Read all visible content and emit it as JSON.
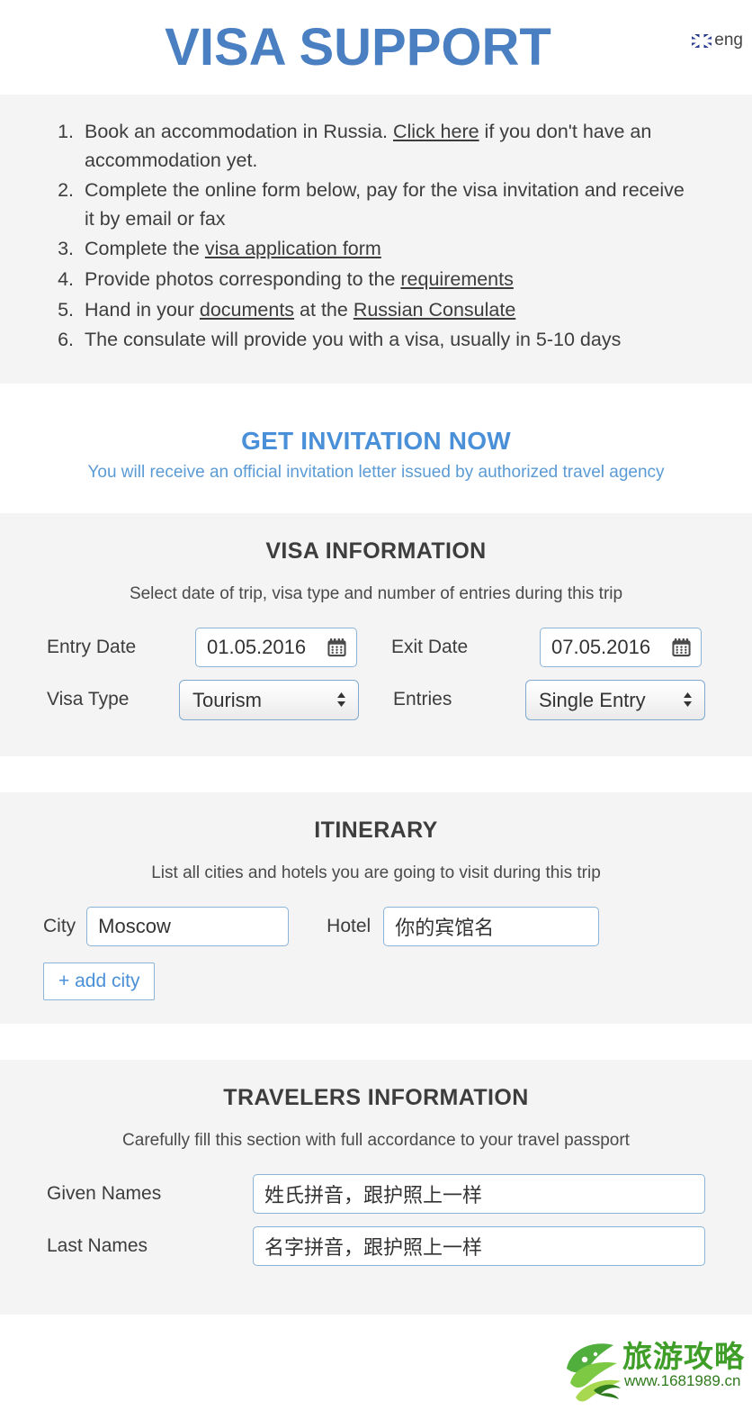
{
  "header": {
    "title": "VISA SUPPORT",
    "lang_code": "eng",
    "flag_icon": "uk-flag-icon",
    "title_color": "#4a7fc1"
  },
  "steps": [
    {
      "prefix": "Book an accommodation in Russia. ",
      "link": "Click here",
      "suffix": " if you don't have an accommodation yet."
    },
    {
      "prefix": "Complete the online form below, pay for the visa invitation and receive it by email or fax",
      "link": "",
      "suffix": ""
    },
    {
      "prefix": "Complete the ",
      "link": "visa application form",
      "suffix": ""
    },
    {
      "prefix": "Provide photos corresponding to the ",
      "link": "requirements",
      "suffix": ""
    },
    {
      "prefix": "Hand in your ",
      "link": "documents",
      "suffix": " at the ",
      "link2": "Russian Consulate"
    },
    {
      "prefix": "The consulate will provide you with a visa, usually in 5-10 days",
      "link": "",
      "suffix": ""
    }
  ],
  "invite": {
    "title": "GET INVITATION NOW",
    "subtitle": "You will receive an official invitation letter issued by authorized travel agency",
    "title_color": "#4a90d9"
  },
  "visa_information": {
    "title": "VISA INFORMATION",
    "subtitle": "Select date of trip, visa type and number of entries during this trip",
    "entry_date_label": "Entry Date",
    "entry_date_value": "01.05.2016",
    "exit_date_label": "Exit Date",
    "exit_date_value": "07.05.2016",
    "visa_type_label": "Visa Type",
    "visa_type_value": "Tourism",
    "visa_type_options": [
      "Tourism"
    ],
    "entries_label": "Entries",
    "entries_value": "Single Entry",
    "entries_options": [
      "Single Entry"
    ],
    "calendar_icon": "calendar-icon"
  },
  "itinerary": {
    "title": "ITINERARY",
    "subtitle": "List all cities and hotels you are going to visit during this trip",
    "city_label": "City",
    "city_value": "Moscow",
    "hotel_label": "Hotel",
    "hotel_value": "你的宾馆名",
    "add_city_label": "+ add city"
  },
  "travelers": {
    "title": "TRAVELERS INFORMATION",
    "subtitle": "Carefully fill this section with full accordance to your travel passport",
    "given_names_label": "Given Names",
    "given_names_value": "姓氏拼音，跟护照上一样",
    "last_names_label": "Last Names",
    "last_names_value": "名字拼音，跟护照上一样"
  },
  "watermark": {
    "text": "旅游攻略",
    "url": "www.1681989.cn",
    "color": "#3f9e28"
  }
}
